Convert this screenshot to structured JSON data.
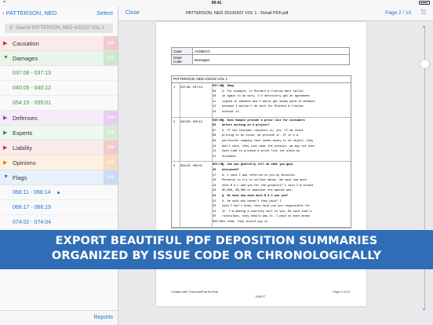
{
  "status": {
    "time": "09:41"
  },
  "sidebar": {
    "back_label": "PATTERSON, NED",
    "select_label": "Select",
    "search_placeholder": "Search PATTERSON, NED 4/22/10 VOL 1",
    "issues": [
      {
        "label": "Causation",
        "color": "#c0392b",
        "edit": "Edit",
        "edit_color": "#f2c9cc",
        "bg": "#fbeaec",
        "expanded": false,
        "children": []
      },
      {
        "label": "Damages",
        "color": "#3e8e41",
        "edit": "Edit",
        "edit_color": "#cfe7cf",
        "bg": "#e9f5e9",
        "expanded": true,
        "children": [
          {
            "label": "037:08 - 037:13"
          },
          {
            "label": "040:05 - 040:12"
          },
          {
            "label": "054:15 - 055:01"
          }
        ]
      },
      {
        "label": "Defenses",
        "color": "#9b3fb5",
        "edit": "Edit",
        "edit_color": "#e9cdf1",
        "bg": "#f6ebf9",
        "expanded": false,
        "children": []
      },
      {
        "label": "Experts",
        "color": "#3e8e41",
        "edit": "Edit",
        "edit_color": "#d4ecd4",
        "bg": "#eef8ee",
        "expanded": false,
        "children": []
      },
      {
        "label": "Liability",
        "color": "#c0392b",
        "edit": "Edit",
        "edit_color": "#f2c9cc",
        "bg": "#fbeaec",
        "expanded": false,
        "children": []
      },
      {
        "label": "Opinions",
        "color": "#e07b13",
        "edit": "Edit",
        "edit_color": "#f8dcc0",
        "bg": "#fdf1e4",
        "expanded": false,
        "children": []
      },
      {
        "label": "Flags",
        "color": "#1a73d8",
        "edit": "Edit",
        "edit_color": "#c9dcf4",
        "bg": "#e8f0fb",
        "expanded": true,
        "children": [
          {
            "label": "066:11 - 066:14",
            "dot": true
          },
          {
            "label": "066:17 - 066:19"
          },
          {
            "label": "074:02 - 074:04"
          }
        ]
      }
    ],
    "reports_label": "Reports"
  },
  "viewer": {
    "close_label": "Close",
    "title": "PATTERSON, NED 20100422 VOL 1 - Detail PDF.pdf",
    "page_indicator": "Page 2 / 10",
    "scroll_position": 0.12
  },
  "document": {
    "meta": [
      {
        "key": "Case",
        "value": "ACMECO"
      },
      {
        "key": "Issue Code",
        "value": "Damages"
      }
    ],
    "section_title": "PATTERSON, NED 4/22/10 VOL 1",
    "entries": [
      {
        "num": "1",
        "range": "037:08 - 037:13",
        "lines": [
          {
            "ln": "037:08",
            "text": "Q.    Okay.",
            "q": true
          },
          {
            "ln": "09",
            "text": "      A.    For example, if Richard & Cranlow were called"
          },
          {
            "ln": "10",
            "text": "in again to do work, I'd definitely get an agreement"
          },
          {
            "ln": "11",
            "text": "signed in advance and I would get money paid in advance"
          },
          {
            "ln": "12",
            "text": "because I wouldn't do work for Richard & Cranlow"
          },
          {
            "ln": "13",
            "text": "without it."
          }
        ]
      },
      {
        "num": "2",
        "range": "040:05 - 040:12",
        "lines": [
          {
            "ln": "040:05",
            "text": "Q.    Does Sample provide a price list for customers",
            "q": true
          },
          {
            "ln": "06",
            "text": "before working on a project?",
            "q": true
          },
          {
            "ln": "07",
            "text": "      A.    If the customer requests it, yes.  If we think"
          },
          {
            "ln": "08",
            "text": "pricing is an issue, we provide it.  If it's a"
          },
          {
            "ln": "09",
            "text": "particular company that seems money is no object, they"
          },
          {
            "ln": "10",
            "text": "don't care, they just want the product, we may not ever"
          },
          {
            "ln": "11",
            "text": "have time to produce a price list let alone an"
          },
          {
            "ln": "12",
            "text": "estimate."
          }
        ]
      },
      {
        "num": "3",
        "range": "054:15 - 055:01",
        "lines": [
          {
            "ln": "054:15",
            "text": "Q.    Can you generally tell me what you guys",
            "q": true
          },
          {
            "ln": "16",
            "text": "discussed?",
            "q": true
          },
          {
            "ln": "17",
            "text": "      A.    I said I was referred to you by Nicholas"
          },
          {
            "ln": "18",
            "text": "Richards to try to collect money.  We said how much"
          },
          {
            "ln": "19",
            "text": "does R & C owe you for the graphics?  I said I'm around"
          },
          {
            "ln": "20",
            "text": "$5,000, $6,000 or whatever the amount was."
          },
          {
            "ln": "21",
            "text": "Q.    He said how much does R & C owe you?",
            "q": true
          },
          {
            "ln": "22",
            "text": "      A.    He said why haven't they paid?  I"
          },
          {
            "ln": "23",
            "text": "said I don't know, they said you are responsible for"
          },
          {
            "ln": "24",
            "text": "it.  I'm making a courtesy call to you.  He said that's"
          },
          {
            "ln": "25",
            "text": "ridiculous, they should pay it.  I paid so much money"
          },
          {
            "ln": "055:01",
            "text": "to them, they should pay it."
          }
        ]
      }
    ],
    "footer_left": "Created with TranscriptPad for iPad",
    "footer_center": "9/26/17",
    "footer_right": "Page 2 of 10"
  },
  "banner": {
    "line1": "EXPORT BEAUTIFUL PDF DEPOSITION SUMMARIES",
    "line2": "ORGANIZED BY ISSUE CODE OR CHRONOLOGICALLY"
  }
}
